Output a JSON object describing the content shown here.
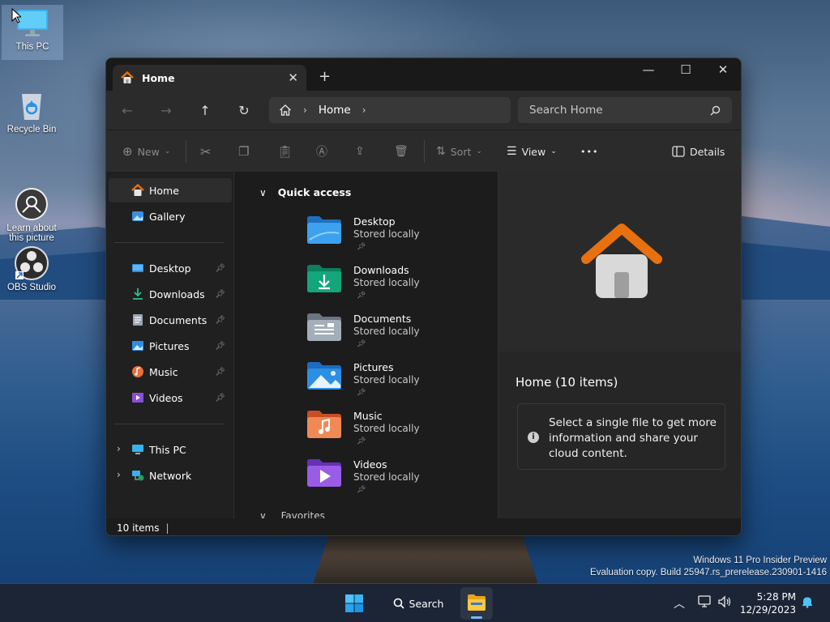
{
  "desktop": {
    "icons": [
      {
        "label": "This PC",
        "icon": "monitor-icon"
      },
      {
        "label": "Recycle Bin",
        "icon": "recycle-bin-icon"
      },
      {
        "label": "Learn about\nthis picture",
        "icon": "camera-icon"
      },
      {
        "label": "OBS Studio",
        "icon": "obs-icon"
      }
    ],
    "watermark": {
      "line1": "Windows 11 Pro Insider Preview",
      "line2": "Evaluation copy. Build 25947.rs_prerelease.230901-1416"
    }
  },
  "explorer": {
    "tab": {
      "label": "Home",
      "close": "✕"
    },
    "new_tab": "+",
    "window_controls": {
      "minimize": "—",
      "maximize": "☐",
      "close": "✕"
    },
    "address": {
      "crumbs": [
        "Home"
      ]
    },
    "search": {
      "placeholder": "Search Home"
    },
    "toolbar": {
      "new_label": "New",
      "sort_label": "Sort",
      "view_label": "View",
      "more_label": "•••",
      "details_label": "Details"
    },
    "sidebar": {
      "top": [
        {
          "label": "Home",
          "icon": "home-icon",
          "active": true
        },
        {
          "label": "Gallery",
          "icon": "gallery-icon"
        }
      ],
      "pinned": [
        {
          "label": "Desktop",
          "icon": "desktop-folder-icon"
        },
        {
          "label": "Downloads",
          "icon": "downloads-folder-icon"
        },
        {
          "label": "Documents",
          "icon": "documents-folder-icon"
        },
        {
          "label": "Pictures",
          "icon": "pictures-folder-icon"
        },
        {
          "label": "Music",
          "icon": "music-folder-icon"
        },
        {
          "label": "Videos",
          "icon": "videos-folder-icon"
        }
      ],
      "locations": [
        {
          "label": "This PC",
          "icon": "monitor-icon"
        },
        {
          "label": "Network",
          "icon": "network-icon"
        }
      ]
    },
    "quick_access": {
      "heading": "Quick access",
      "items": [
        {
          "name": "Desktop",
          "status": "Stored locally",
          "icon": "desktop-folder-icon",
          "color": "#2e8fe0"
        },
        {
          "name": "Downloads",
          "status": "Stored locally",
          "icon": "downloads-folder-icon",
          "color": "#13a67a"
        },
        {
          "name": "Documents",
          "status": "Stored locally",
          "icon": "documents-folder-icon",
          "color": "#8f9aa8"
        },
        {
          "name": "Pictures",
          "status": "Stored locally",
          "icon": "pictures-folder-icon",
          "color": "#2d8fe3"
        },
        {
          "name": "Music",
          "status": "Stored locally",
          "icon": "music-folder-icon",
          "color": "#e96e3c"
        },
        {
          "name": "Videos",
          "status": "Stored locally",
          "icon": "videos-folder-icon",
          "color": "#8b4fd6"
        }
      ],
      "next_heading": "Favorites"
    },
    "details": {
      "title": "Home (10 items)",
      "info": "Select a single file to get more information and share your cloud content."
    },
    "status": {
      "count": "10 items"
    }
  },
  "taskbar": {
    "search_label": "Search",
    "time": "5:28 PM",
    "date": "12/29/2023"
  },
  "colors": {
    "accent": "#7fb6ff",
    "home_orange": "#e8700f"
  }
}
